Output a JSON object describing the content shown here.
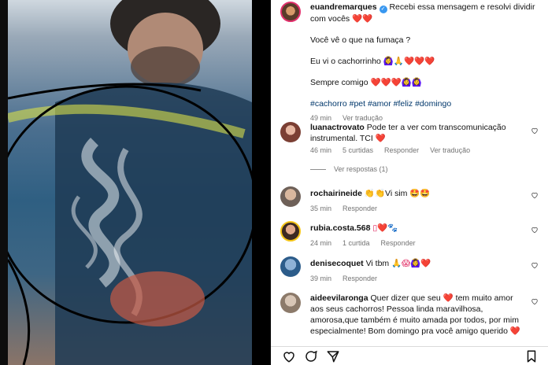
{
  "caption": {
    "username": "euandremarques",
    "text_1": "Recebi essa mensagem e resolvi dividir com vocês",
    "hearts_1": "❤️❤️",
    "line_2": "Você vê o que na fumaça ?",
    "line_3": "Eu vi o cachorrinho",
    "line_3_emoji": "🙆‍♀️🙏❤️❤️❤️",
    "line_4": "Sempre comigo",
    "line_4_emoji": "❤️❤️❤️🙆‍♀️🙆‍♀️",
    "hashtags": "#cachorro #pet #amor #feliz #domingo",
    "time": "49 min",
    "see_translation": "Ver tradução"
  },
  "comments": [
    {
      "username": "luanactrovato",
      "text": "Pode ter a ver com transcomunicação instrumental. TCI",
      "emoji": "❤️",
      "time": "46 min",
      "likes": "5 curtidas",
      "reply": "Responder",
      "translation": "Ver tradução",
      "replies": "Ver respostas (1)"
    },
    {
      "username": "rochairineide",
      "text": "👏👏Vi sim",
      "emoji": "🤩🤩",
      "time": "35 min",
      "reply": "Responder"
    },
    {
      "username": "rubia.costa.568",
      "text": "▯❤️🐾",
      "time": "24 min",
      "likes": "1 curtida",
      "reply": "Responder"
    },
    {
      "username": "denisecoquet",
      "text": "Vi tbm",
      "emoji": "🙏😱🙆‍♀️❤️",
      "time": "39 min",
      "reply": "Responder"
    },
    {
      "username": "aideevilaronga",
      "text": "Quer dizer que seu ❤️ tem muito amor aos seus cachorros! Pessoa linda maravilhosa, amorosa,que também é muito amada por todos, por mim especialmente! Bom domingo pra você amigo querido",
      "emoji": "❤️"
    }
  ],
  "colors": {
    "heart": "#e0245e",
    "link": "#00376b",
    "meta": "#737373",
    "verified": "#3897f0"
  },
  "icons": [
    "heart-icon",
    "comment-icon",
    "share-icon",
    "bookmark-icon",
    "verified-icon"
  ]
}
